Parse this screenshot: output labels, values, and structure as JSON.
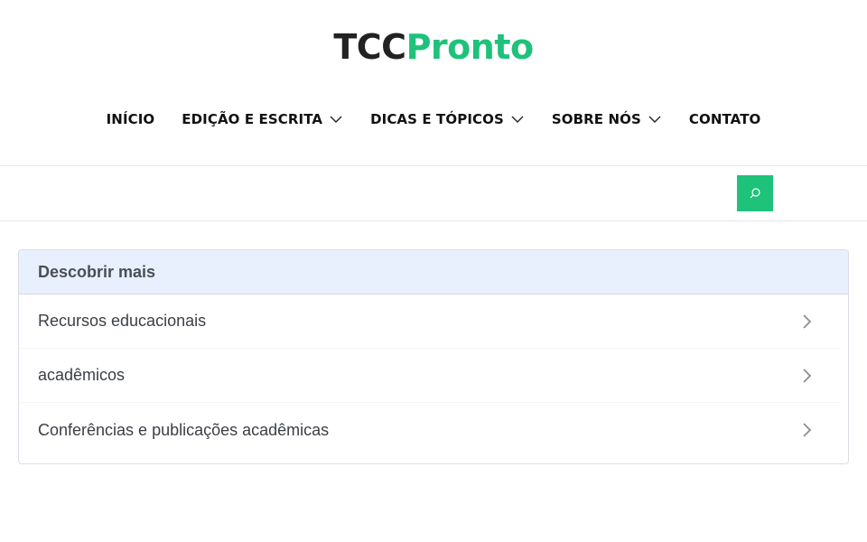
{
  "logo": {
    "part1": "TCC",
    "part2": "Pronto"
  },
  "nav": {
    "items": [
      {
        "label": "INÍCIO",
        "dropdown": false
      },
      {
        "label": "EDIÇÃO E ESCRITA",
        "dropdown": true
      },
      {
        "label": "DICAS E TÓPICOS",
        "dropdown": true
      },
      {
        "label": "SOBRE NÓS",
        "dropdown": true
      },
      {
        "label": "CONTATO",
        "dropdown": false
      }
    ]
  },
  "search": {
    "icon": "search-icon",
    "color": "#1ec27a"
  },
  "discover": {
    "title": "Descobrir mais",
    "items": [
      {
        "label": "Recursos educacionais"
      },
      {
        "label": "acadêmicos"
      },
      {
        "label": "Conferências e publicações acadêmicas"
      }
    ]
  },
  "colors": {
    "accent": "#1ec27a",
    "header_bg": "#e8f0fe"
  }
}
